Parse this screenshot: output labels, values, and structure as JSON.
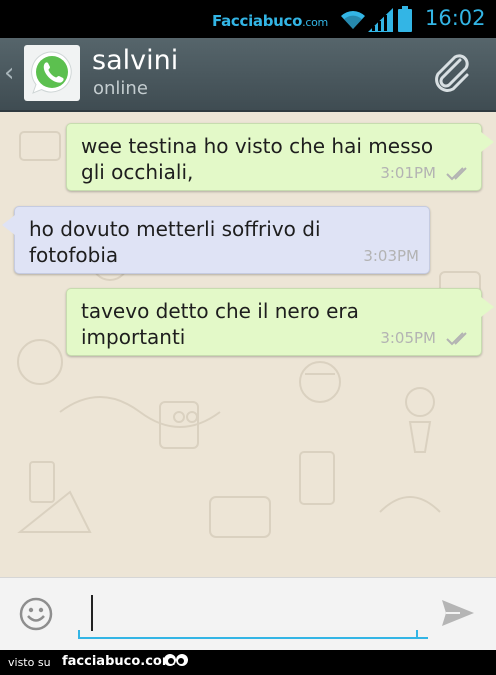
{
  "status_bar": {
    "brand": "Facciabuco",
    "brand_domain": ".com",
    "time": "16:02",
    "icons": [
      "wifi-icon",
      "signal-icon",
      "battery-icon"
    ],
    "accent_color": "#33b5e5"
  },
  "header": {
    "back_icon": "chevron-left-icon",
    "avatar_icon": "whatsapp-logo-icon",
    "contact_name": "salvini",
    "contact_status": "online",
    "attach_icon": "paperclip-icon",
    "bar_color": "#4a575d"
  },
  "messages": [
    {
      "direction": "outgoing",
      "text": "wee testina ho visto che hai messo\ngli occhiali,",
      "time": "3:01PM",
      "status_icon": "double-check-icon",
      "bubble_color": "#e3f9c8"
    },
    {
      "direction": "incoming",
      "text": "ho dovuto metterli soffrivo di\nfotofobia",
      "time": "3:03PM",
      "bubble_color": "#dfe3f5"
    },
    {
      "direction": "outgoing",
      "text": "tavevo detto che il nero era\nimportanti",
      "time": "3:05PM",
      "status_icon": "double-check-icon",
      "bubble_color": "#e3f9c8"
    }
  ],
  "composer": {
    "emoji_icon": "smiley-icon",
    "value": "",
    "send_icon": "send-icon"
  },
  "footer": {
    "prefix": "visto su",
    "brand": "facciabuco.com",
    "logo_icon": "eyes-logo-icon"
  },
  "colors": {
    "chat_background": "#ede5d6",
    "input_underline": "#33b5e5"
  }
}
